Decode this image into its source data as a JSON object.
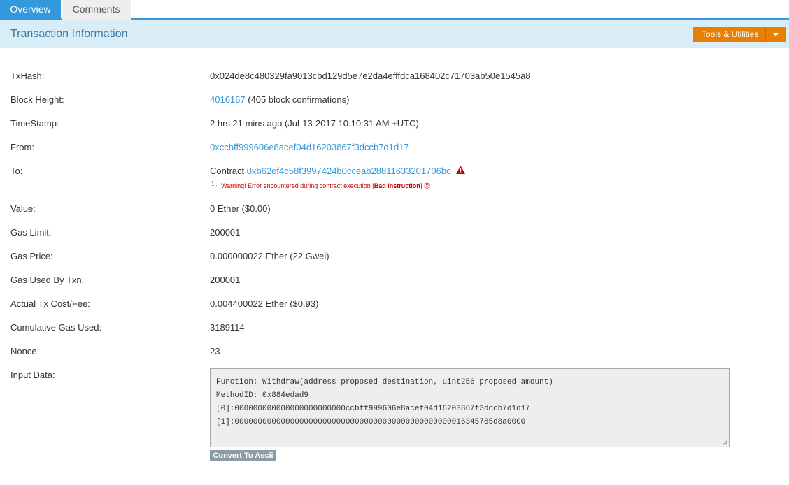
{
  "tabs": [
    {
      "label": "Overview"
    },
    {
      "label": "Comments"
    }
  ],
  "header": {
    "title": "Transaction Information",
    "tools_label": "Tools & Utilities"
  },
  "fields": {
    "txhash": {
      "label": "TxHash:",
      "value": "0x024de8c480329fa9013cbd129d5e7e2da4efffdca168402c71703ab50e1545a8"
    },
    "block_height": {
      "label": "Block Height:",
      "link": "4016167",
      "suffix": " (405 block confirmations)"
    },
    "timestamp": {
      "label": "TimeStamp:",
      "value": "2 hrs 21 mins ago (Jul-13-2017 10:10:31 AM +UTC)"
    },
    "from": {
      "label": "From:",
      "link": "0xccbff999606e8acef04d16203867f3dccb7d1d17"
    },
    "to": {
      "label": "To:",
      "prefix": "Contract ",
      "link": "0xb62ef4c58f3997424b0cceab28811633201706bc",
      "warning_prefix": "Warning! Error encountered during contract execution [",
      "warning_bold": "Bad instruction",
      "warning_suffix": "] ☹"
    },
    "value": {
      "label": "Value:",
      "value": "0 Ether ($0.00)"
    },
    "gas_limit": {
      "label": "Gas Limit:",
      "value": "200001"
    },
    "gas_price": {
      "label": "Gas Price:",
      "value": "0.000000022 Ether (22 Gwei)"
    },
    "gas_used": {
      "label": "Gas Used By Txn:",
      "value": "200001"
    },
    "tx_fee": {
      "label": "Actual Tx Cost/Fee:",
      "value": "0.004400022 Ether ($0.93)"
    },
    "cumulative_gas": {
      "label": "Cumulative Gas Used:",
      "value": "3189114"
    },
    "nonce": {
      "label": "Nonce:",
      "value": "23"
    },
    "input_data": {
      "label": "Input Data:",
      "lines": [
        "Function: Withdraw(address proposed_destination, uint256 proposed_amount)",
        "",
        "MethodID: 0x884edad9",
        "[0]:000000000000000000000000ccbff999606e8acef04d16203867f3dccb7d1d17",
        "[1]:00000000000000000000000000000000000000000000000016345785d8a0000"
      ]
    }
  },
  "buttons": {
    "convert_ascii": "Convert To Ascii"
  },
  "colors": {
    "accent": "#3598dc",
    "tools": "#e87e04",
    "warning": "#cc0000"
  }
}
